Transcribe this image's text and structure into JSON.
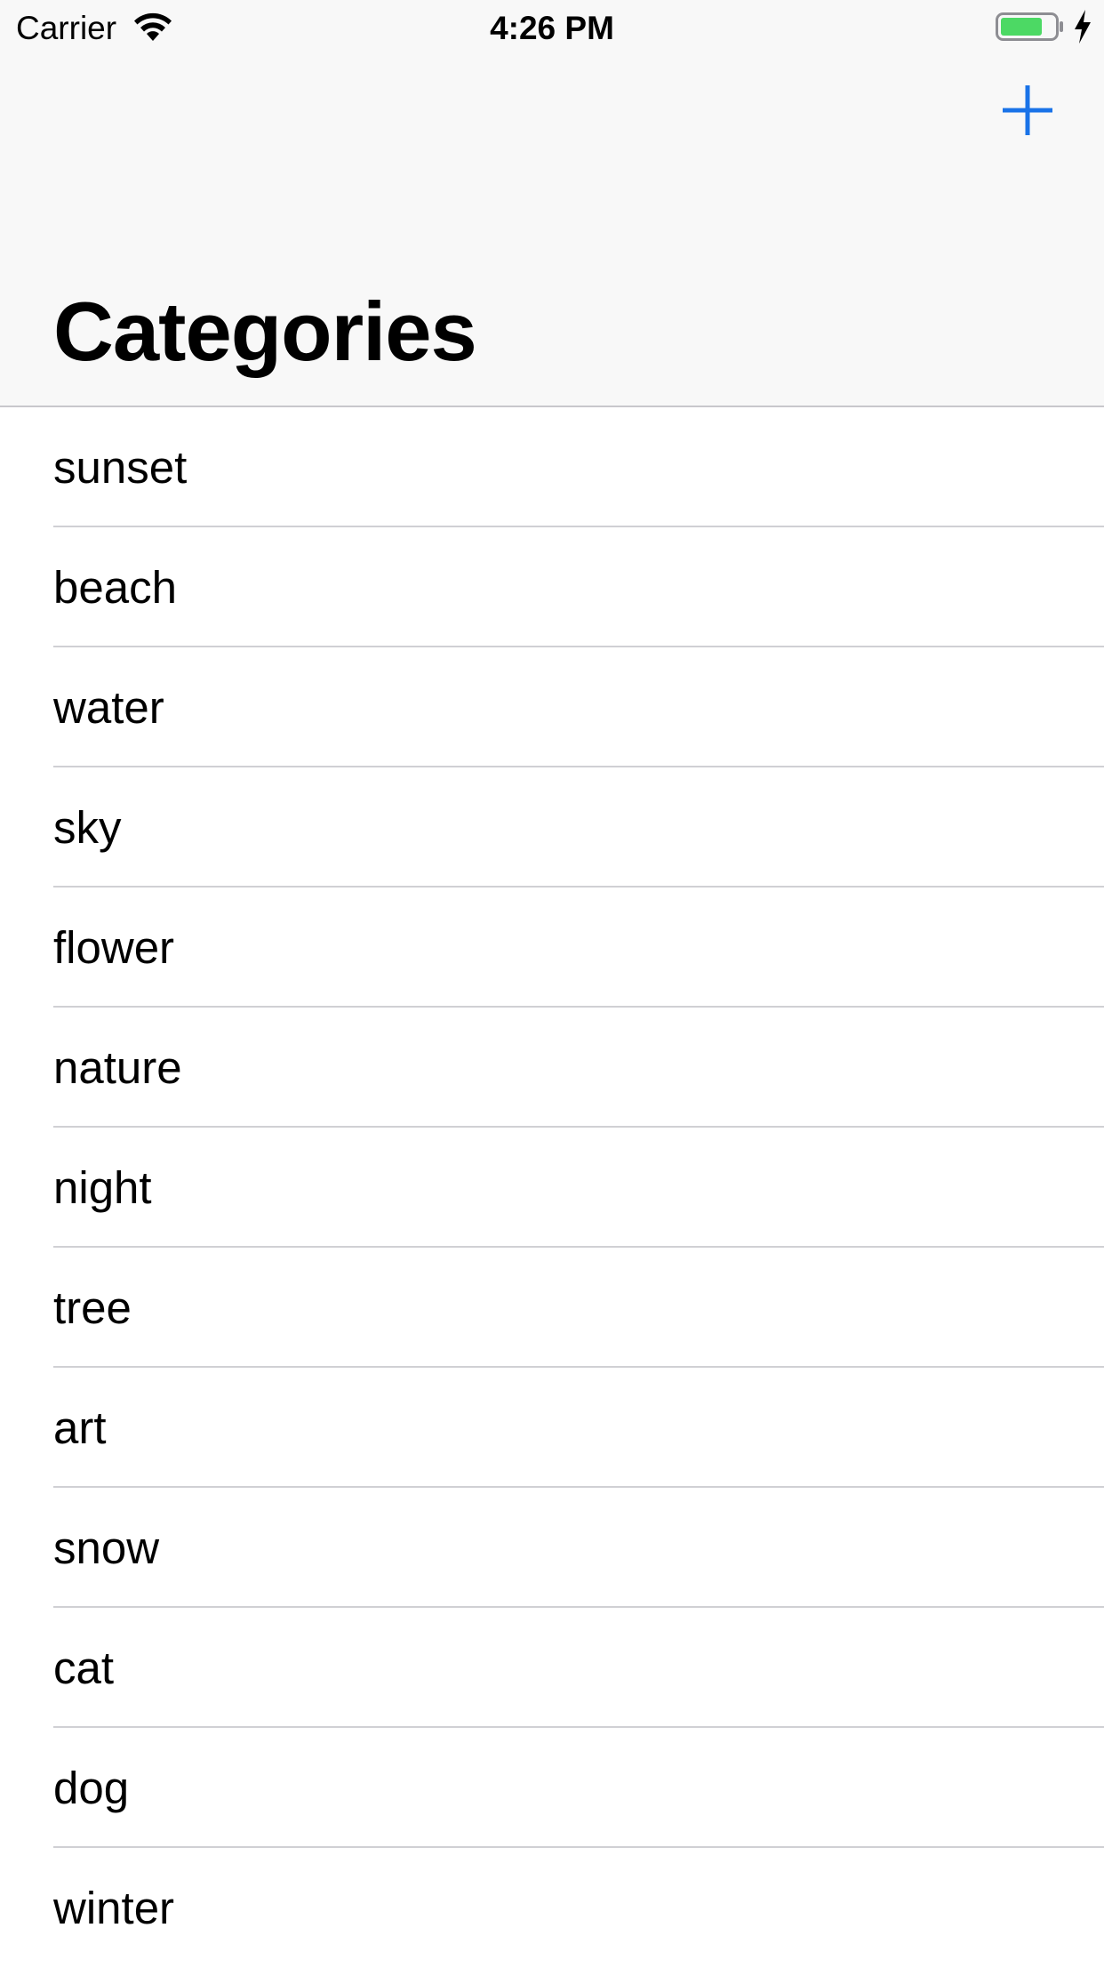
{
  "status_bar": {
    "carrier": "Carrier",
    "time": "4:26 PM"
  },
  "nav": {
    "title": "Categories",
    "add_icon": "plus-icon"
  },
  "categories": [
    {
      "label": "sunset"
    },
    {
      "label": "beach"
    },
    {
      "label": "water"
    },
    {
      "label": "sky"
    },
    {
      "label": "flower"
    },
    {
      "label": "nature"
    },
    {
      "label": "night"
    },
    {
      "label": "tree"
    },
    {
      "label": "art"
    },
    {
      "label": "snow"
    },
    {
      "label": "cat"
    },
    {
      "label": "dog"
    },
    {
      "label": "winter"
    }
  ],
  "colors": {
    "accent": "#1a73e8",
    "battery_fill": "#4cd964",
    "nav_background": "#f8f8f8",
    "separator": "#d0d0d4"
  }
}
